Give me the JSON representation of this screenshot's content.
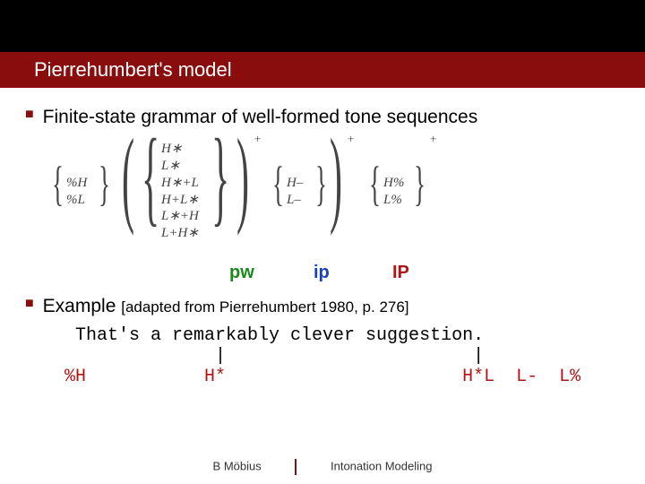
{
  "title": "Pierrehumbert's model",
  "bullet1": "Finite-state grammar of well-formed tone sequences",
  "formula": {
    "col1_items": "%H\n%L",
    "col2_items": "H∗\nL∗\nH∗+L\nH+L∗\nL∗+H\nL+H∗",
    "col3_items": "H–\nL–",
    "col4_items": "H%\nL%",
    "sup_plus": "+"
  },
  "levels": {
    "pw": "pw",
    "ip": "ip",
    "IP": "IP"
  },
  "bullet2_lead": "Example ",
  "bullet2_cite": "[adapted from Pierrehumbert 1980, p. 276]",
  "example_text": "That's a remarkably clever suggestion.",
  "example_bars": "             |                       |",
  "example_tones": " %H           H*                      H*L  L-  L%",
  "footer_left": "B Möbius",
  "footer_right": "Intonation Modeling"
}
